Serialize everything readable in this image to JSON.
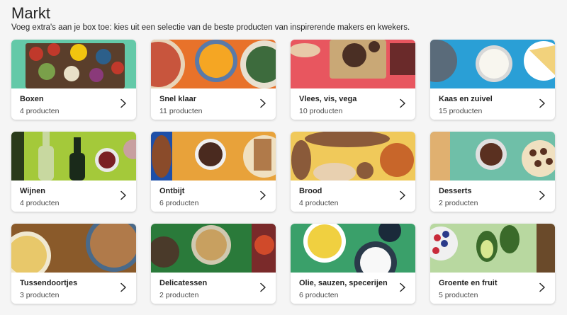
{
  "header": {
    "title": "Markt",
    "subtitle": "Voeg extra's aan je box toe: kies uit een selectie van de beste producten van inspirerende makers en kwekers."
  },
  "categories": [
    {
      "name": "Boxen",
      "count": "4 producten",
      "image": "boxes-produce-image",
      "colors": [
        "#64c9a8",
        "#c0392b",
        "#f1c40f",
        "#5a3e2b"
      ]
    },
    {
      "name": "Snel klaar",
      "count": "11 producten",
      "image": "quick-meals-image",
      "colors": [
        "#e8722a",
        "#c8553d",
        "#f5a623",
        "#3d6b3d"
      ]
    },
    {
      "name": "Vlees, vis, vega",
      "count": "10 producten",
      "image": "meat-fish-veg-image",
      "colors": [
        "#e8565f",
        "#c9a876",
        "#4a2f24",
        "#e8c9a8"
      ]
    },
    {
      "name": "Kaas en zuivel",
      "count": "15 producten",
      "image": "cheese-dairy-image",
      "colors": [
        "#2a9fd6",
        "#5a6b7a",
        "#f8f6ef",
        "#f2d27c"
      ]
    },
    {
      "name": "Wijnen",
      "count": "4 producten",
      "image": "wines-image",
      "colors": [
        "#a4c93a",
        "#3b5a2a",
        "#d8d8c0",
        "#7a1f24"
      ]
    },
    {
      "name": "Ontbijt",
      "count": "6 producten",
      "image": "breakfast-image",
      "colors": [
        "#e8a23a",
        "#8a4b2a",
        "#4a2a1f",
        "#1e4fa8"
      ]
    },
    {
      "name": "Brood",
      "count": "4 producten",
      "image": "bread-image",
      "colors": [
        "#f0c95a",
        "#8a5a3a",
        "#c8662a",
        "#e8d0b0"
      ]
    },
    {
      "name": "Desserts",
      "count": "2 producten",
      "image": "desserts-image",
      "colors": [
        "#6fbfa8",
        "#e0b070",
        "#5a3020",
        "#f0e0c0"
      ]
    },
    {
      "name": "Tussendoortjes",
      "count": "3 producten",
      "image": "snacks-image",
      "colors": [
        "#8a5a2a",
        "#e8c86a",
        "#b07a4a",
        "#4a6a8a"
      ]
    },
    {
      "name": "Delicatessen",
      "count": "2 producten",
      "image": "delicatessen-image",
      "colors": [
        "#2a7a3a",
        "#c8a060",
        "#7a2a2a",
        "#d04a2a"
      ]
    },
    {
      "name": "Olie, sauzen, specerijen",
      "count": "6 producten",
      "image": "oil-sauces-spices-image",
      "colors": [
        "#3aa06a",
        "#f0d040",
        "#1a2a3a",
        "#f8f8f8"
      ]
    },
    {
      "name": "Groente en fruit",
      "count": "5 producten",
      "image": "vegetables-fruit-image",
      "colors": [
        "#b8d8a0",
        "#3a6a2a",
        "#2a3a8a",
        "#c82a3a"
      ]
    }
  ],
  "icons": {
    "chevron": "chevron-right-icon"
  }
}
